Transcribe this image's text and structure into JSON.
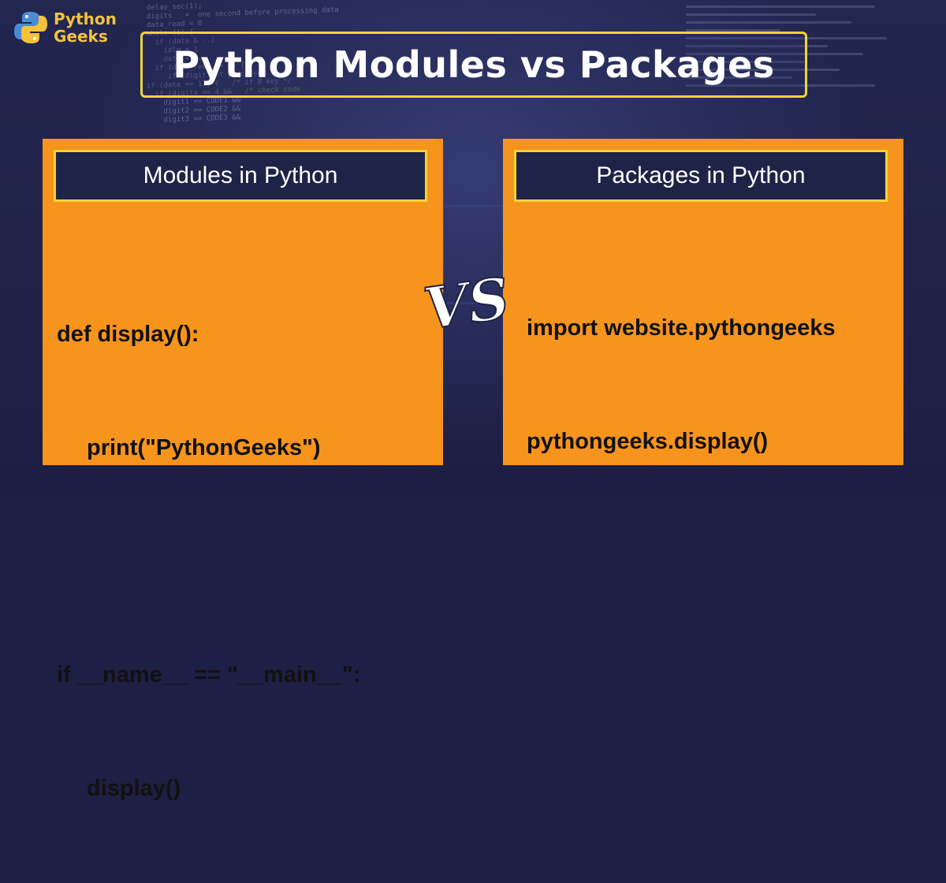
{
  "brand": {
    "line1": "Python",
    "line2": "Geeks",
    "colors": {
      "primary": "#f5c23a",
      "secondary": "#4b8bd6"
    }
  },
  "title": "Python Modules vs Packages",
  "vs_label": "VS",
  "left_panel": {
    "header": "Modules in Python",
    "code": [
      {
        "text": "def display():",
        "indent": false
      },
      {
        "text": "print(\"PythonGeeks\")",
        "indent": true
      },
      {
        "text": "if __name__ == \"__main__\":",
        "indent": false
      },
      {
        "text": "display()",
        "indent": true
      }
    ]
  },
  "right_panel": {
    "header": "Packages in Python",
    "code": [
      {
        "text": "import website.pythongeeks",
        "indent": false
      },
      {
        "text": "pythongeeks.display()",
        "indent": false
      }
    ]
  },
  "colors": {
    "background": "#1e1f45",
    "panel": "#f7941d",
    "header_bg": "#1f2347",
    "accent_border": "#f1d535"
  }
}
